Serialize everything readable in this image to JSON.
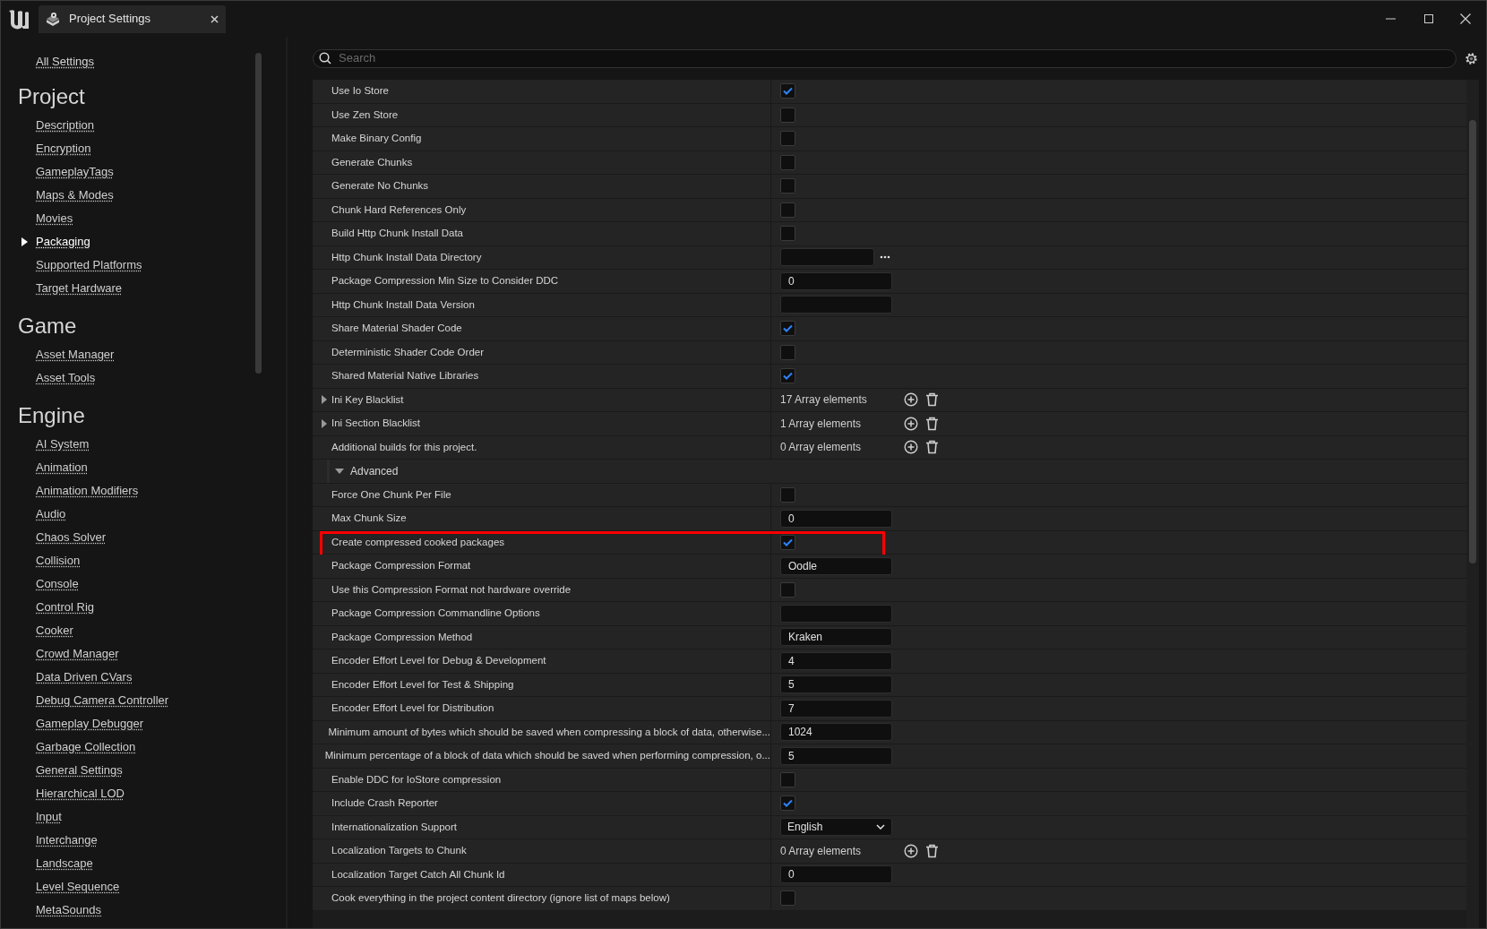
{
  "window": {
    "tab_title": "Project Settings"
  },
  "sidebar": {
    "all_settings": "All Settings",
    "sections": [
      {
        "title": "Project",
        "items": [
          {
            "label": "Description",
            "selected": false
          },
          {
            "label": "Encryption",
            "selected": false
          },
          {
            "label": "GameplayTags",
            "selected": false
          },
          {
            "label": "Maps & Modes",
            "selected": false
          },
          {
            "label": "Movies",
            "selected": false
          },
          {
            "label": "Packaging",
            "selected": true
          },
          {
            "label": "Supported Platforms",
            "selected": false
          },
          {
            "label": "Target Hardware",
            "selected": false
          }
        ]
      },
      {
        "title": "Game",
        "items": [
          {
            "label": "Asset Manager",
            "selected": false
          },
          {
            "label": "Asset Tools",
            "selected": false
          }
        ]
      },
      {
        "title": "Engine",
        "items": [
          {
            "label": "AI System",
            "selected": false
          },
          {
            "label": "Animation",
            "selected": false
          },
          {
            "label": "Animation Modifiers",
            "selected": false
          },
          {
            "label": "Audio",
            "selected": false
          },
          {
            "label": "Chaos Solver",
            "selected": false
          },
          {
            "label": "Collision",
            "selected": false
          },
          {
            "label": "Console",
            "selected": false
          },
          {
            "label": "Control Rig",
            "selected": false
          },
          {
            "label": "Cooker",
            "selected": false
          },
          {
            "label": "Crowd Manager",
            "selected": false
          },
          {
            "label": "Data Driven CVars",
            "selected": false
          },
          {
            "label": "Debug Camera Controller",
            "selected": false
          },
          {
            "label": "Gameplay Debugger",
            "selected": false
          },
          {
            "label": "Garbage Collection",
            "selected": false
          },
          {
            "label": "General Settings",
            "selected": false
          },
          {
            "label": "Hierarchical LOD",
            "selected": false
          },
          {
            "label": "Input",
            "selected": false
          },
          {
            "label": "Interchange",
            "selected": false
          },
          {
            "label": "Landscape",
            "selected": false
          },
          {
            "label": "Level Sequence",
            "selected": false
          },
          {
            "label": "MetaSounds",
            "selected": false
          }
        ]
      }
    ]
  },
  "search": {
    "placeholder": "Search"
  },
  "rows": [
    {
      "label": "Use Io Store",
      "kind": "checkbox",
      "checked": true,
      "highlighted": false
    },
    {
      "label": "Use Zen Store",
      "kind": "checkbox",
      "checked": false,
      "highlighted": false
    },
    {
      "label": "Make Binary Config",
      "kind": "checkbox",
      "checked": false,
      "highlighted": false
    },
    {
      "label": "Generate Chunks",
      "kind": "checkbox",
      "checked": false,
      "highlighted": false
    },
    {
      "label": "Generate No Chunks",
      "kind": "checkbox",
      "checked": false,
      "highlighted": false
    },
    {
      "label": "Chunk Hard References Only",
      "kind": "checkbox",
      "checked": false,
      "highlighted": false
    },
    {
      "label": "Build Http Chunk Install Data",
      "kind": "checkbox",
      "checked": false,
      "highlighted": false
    },
    {
      "label": "Http Chunk Install Data Directory",
      "kind": "path",
      "highlighted": false
    },
    {
      "label": "Package Compression Min Size to Consider DDC",
      "kind": "text",
      "value": "0",
      "highlighted": false
    },
    {
      "label": "Http Chunk Install Data Version",
      "kind": "text",
      "highlighted": false
    },
    {
      "label": "Share Material Shader Code",
      "kind": "checkbox",
      "checked": true,
      "highlighted": false
    },
    {
      "label": "Deterministic Shader Code Order",
      "kind": "checkbox",
      "checked": false,
      "highlighted": false
    },
    {
      "label": "Shared Material Native Libraries",
      "kind": "checkbox",
      "checked": true,
      "highlighted": false
    },
    {
      "label": "Ini Key Blacklist",
      "kind": "array",
      "count": "17 Array elements",
      "expanded": false,
      "highlighted": false
    },
    {
      "label": "Ini Section Blacklist",
      "kind": "array",
      "count": "1 Array elements",
      "expanded": false,
      "highlighted": false
    },
    {
      "label": "Additional builds for this project.",
      "kind": "array",
      "count": "0 Array elements",
      "highlighted": false
    },
    {
      "label": "Advanced",
      "kind": "category",
      "expanded": true,
      "highlighted": false
    },
    {
      "label": "Force One Chunk Per File",
      "kind": "checkbox",
      "checked": false,
      "highlighted": false
    },
    {
      "label": "Max Chunk Size",
      "kind": "text",
      "value": "0",
      "highlighted": false
    },
    {
      "label": "Create compressed cooked packages",
      "kind": "checkbox",
      "checked": true,
      "highlighted": true
    },
    {
      "label": "Package Compression Format",
      "kind": "text",
      "value": "Oodle",
      "highlighted": false
    },
    {
      "label": "Use this Compression Format not hardware override",
      "kind": "checkbox",
      "checked": false,
      "highlighted": false
    },
    {
      "label": "Package Compression Commandline Options",
      "kind": "text",
      "highlighted": false
    },
    {
      "label": "Package Compression Method",
      "kind": "text",
      "value": "Kraken",
      "highlighted": false
    },
    {
      "label": "Encoder Effort Level for Debug & Development",
      "kind": "text",
      "value": "4",
      "highlighted": false
    },
    {
      "label": "Encoder Effort Level for Test & Shipping",
      "kind": "text",
      "value": "5",
      "highlighted": false
    },
    {
      "label": "Encoder Effort Level for Distribution",
      "kind": "text",
      "value": "7",
      "highlighted": false
    },
    {
      "label": "Minimum amount of bytes which should be saved when compressing a block of data, otherwise...",
      "kind": "text",
      "value": "1024",
      "highlighted": false
    },
    {
      "label": "Minimum percentage of a block of data which should be saved when performing compression, o...",
      "kind": "text",
      "value": "5",
      "highlighted": false
    },
    {
      "label": "Enable DDC for IoStore compression",
      "kind": "checkbox",
      "checked": false,
      "highlighted": false
    },
    {
      "label": "Include Crash Reporter",
      "kind": "checkbox",
      "checked": true,
      "highlighted": false
    },
    {
      "label": "Internationalization Support",
      "kind": "dropdown",
      "value": "English",
      "highlighted": false
    },
    {
      "label": "Localization Targets to Chunk",
      "kind": "array",
      "count": "0 Array elements",
      "highlighted": false
    },
    {
      "label": "Localization Target Catch All Chunk Id",
      "kind": "text",
      "value": "0",
      "highlighted": false
    },
    {
      "label": "Cook everything in the project content directory (ignore list of maps below)",
      "kind": "checkbox",
      "checked": false,
      "highlighted": false
    }
  ]
}
